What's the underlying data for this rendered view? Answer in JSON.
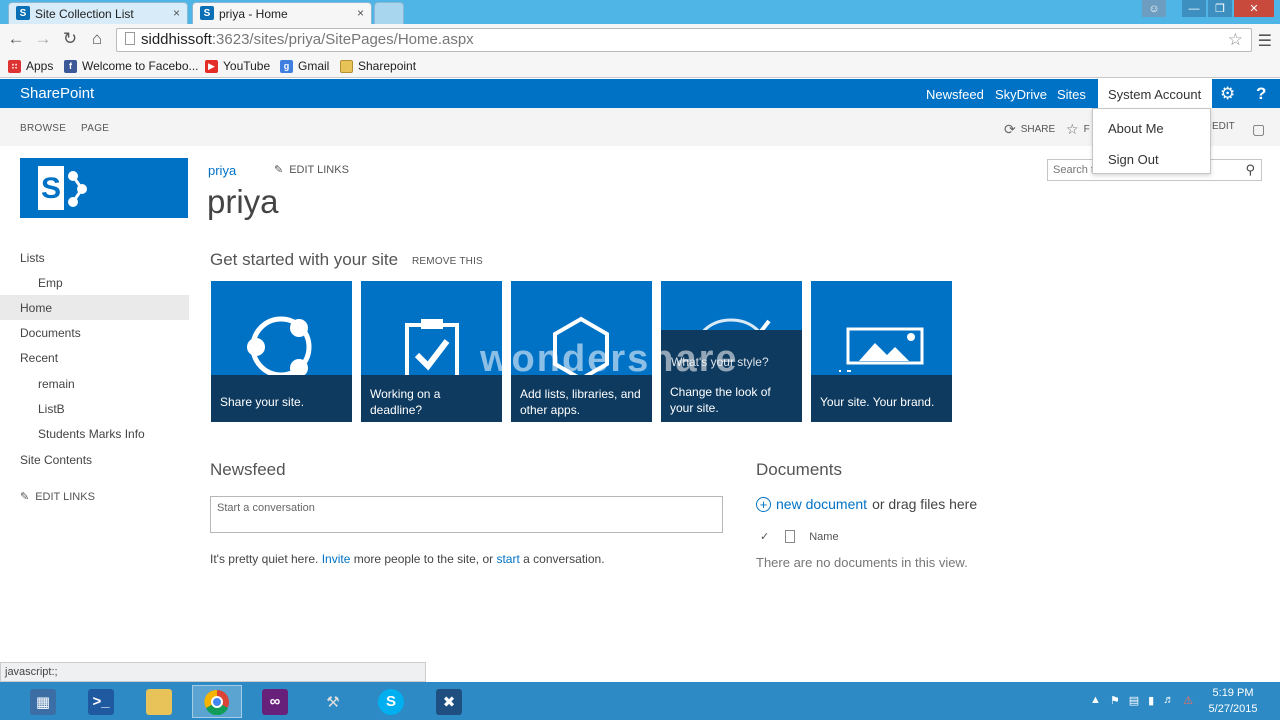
{
  "browser": {
    "tabs": [
      {
        "label": "Site Collection List",
        "close": "×"
      },
      {
        "label": "priya - Home",
        "close": "×"
      }
    ],
    "url_host": "siddhissoft",
    "url_path": ":3623/sites/priya/SitePages/Home.aspx",
    "bookmarks": [
      "Apps",
      "Welcome to Facebo...",
      "YouTube",
      "Gmail",
      "Sharepoint"
    ],
    "status_text": "javascript:;"
  },
  "suite": {
    "brand": "SharePoint",
    "links": [
      "Newsfeed",
      "SkyDrive",
      "Sites"
    ],
    "account": "System Account",
    "account_menu": [
      "About Me",
      "Sign Out"
    ]
  },
  "ribbon": {
    "tabs": [
      "BROWSE",
      "PAGE"
    ],
    "share": "SHARE",
    "follow": "F",
    "edit": "EDIT"
  },
  "site": {
    "breadcrumb": "priya",
    "edit_links": "EDIT LINKS",
    "title": "priya",
    "search_placeholder": "Search t"
  },
  "quick_launch": [
    {
      "label": "Lists",
      "indent": false
    },
    {
      "label": "Emp",
      "indent": true
    },
    {
      "label": "Home",
      "indent": false,
      "selected": true
    },
    {
      "label": "Documents",
      "indent": false
    },
    {
      "label": "Recent",
      "indent": false
    },
    {
      "label": "remain",
      "indent": true
    },
    {
      "label": "ListB",
      "indent": true
    },
    {
      "label": "Students Marks Info",
      "indent": true
    },
    {
      "label": "Site Contents",
      "indent": false
    }
  ],
  "quick_launch_edit": "EDIT LINKS",
  "get_started": {
    "heading": "Get started with your site",
    "remove": "REMOVE THIS",
    "tiles": [
      {
        "caption": "Share your site.",
        "icon": "share-icon"
      },
      {
        "caption": "Working on a deadline?",
        "icon": "clipboard-check-icon"
      },
      {
        "caption": "Add lists, libraries, and other apps.",
        "icon": "apps-hexagon-icon"
      },
      {
        "caption": "Change the look of your site.",
        "overlay": "What's your style?",
        "icon": "palette-icon"
      },
      {
        "caption": "Your site. Your brand.",
        "icon": "image-brand-icon"
      }
    ]
  },
  "newsfeed": {
    "heading": "Newsfeed",
    "placeholder": "Start a conversation",
    "quiet_pre": "It's pretty quiet here. ",
    "invite": "Invite",
    "quiet_mid": " more people to the site, or ",
    "start": "start",
    "quiet_post": " a conversation."
  },
  "documents": {
    "heading": "Documents",
    "new_doc": "new document",
    "drag_text": " or drag files here",
    "col_name": "Name",
    "empty": "There are no documents in this view."
  },
  "watermark": "wondershare",
  "taskbar": {
    "time": "5:19 PM",
    "date": "5/27/2015"
  },
  "colors": {
    "sharepoint_blue": "#0072c6",
    "tile_caption": "#0e3a5f",
    "taskbar": "#2e8ac4"
  }
}
